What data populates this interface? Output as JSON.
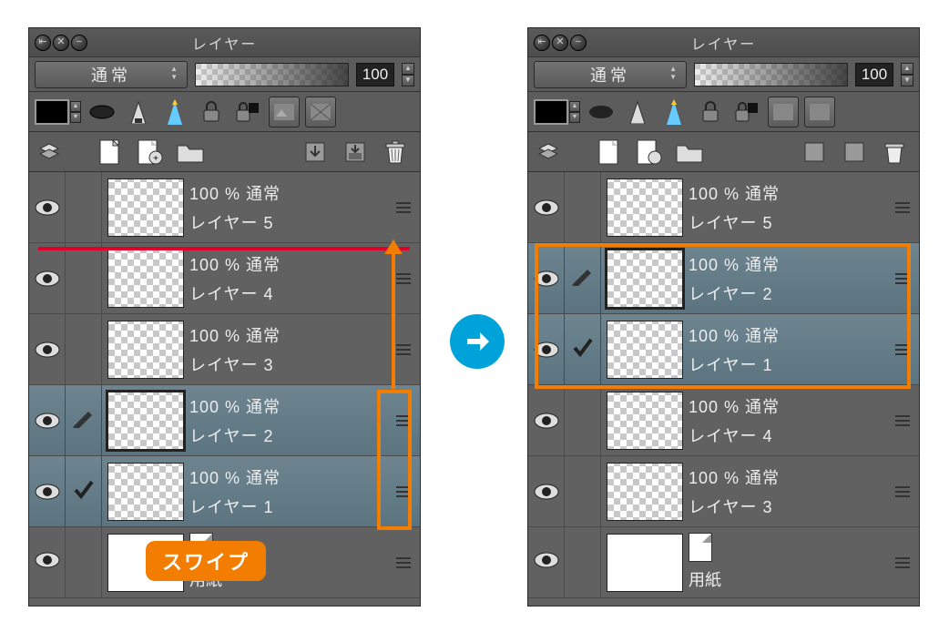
{
  "panel_title": "レイヤー",
  "blend_mode": "通常",
  "opacity_value": "100",
  "swipe_label": "スワイプ",
  "layer_label": {
    "l5_op": "100 % 通常",
    "l5_nm": "レイヤー 5",
    "l4_op": "100 % 通常",
    "l4_nm": "レイヤー 4",
    "l3_op": "100 % 通常",
    "l3_nm": "レイヤー 3",
    "l2_op": "100 % 通常",
    "l2_nm": "レイヤー 2",
    "l1_op": "100 % 通常",
    "l1_nm": "レイヤー 1"
  },
  "paper_label": "用紙",
  "left_panel": {
    "layers": [
      {
        "op": "l5_op",
        "nm": "l5_nm",
        "selected": false,
        "active": false,
        "mark": null
      },
      {
        "op": "l4_op",
        "nm": "l4_nm",
        "selected": false,
        "active": false,
        "mark": null
      },
      {
        "op": "l3_op",
        "nm": "l3_nm",
        "selected": false,
        "active": false,
        "mark": null
      },
      {
        "op": "l2_op",
        "nm": "l2_nm",
        "selected": true,
        "active": true,
        "mark": "brush"
      },
      {
        "op": "l1_op",
        "nm": "l1_nm",
        "selected": true,
        "active": false,
        "mark": "check"
      }
    ]
  },
  "right_panel": {
    "layers": [
      {
        "op": "l5_op",
        "nm": "l5_nm",
        "selected": false,
        "active": false,
        "mark": null
      },
      {
        "op": "l2_op",
        "nm": "l2_nm",
        "selected": true,
        "active": true,
        "mark": "brush"
      },
      {
        "op": "l1_op",
        "nm": "l1_nm",
        "selected": true,
        "active": false,
        "mark": "check"
      },
      {
        "op": "l4_op",
        "nm": "l4_nm",
        "selected": false,
        "active": false,
        "mark": null
      },
      {
        "op": "l3_op",
        "nm": "l3_nm",
        "selected": false,
        "active": false,
        "mark": null
      }
    ]
  }
}
